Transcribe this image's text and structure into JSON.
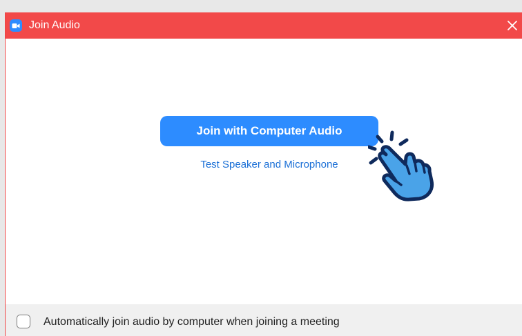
{
  "window": {
    "title": "Join Audio",
    "app_icon": "zoom-video-icon",
    "close_icon": "close-icon"
  },
  "main": {
    "join_button_label": "Join with Computer Audio",
    "test_link_label": "Test Speaker and Microphone",
    "pointer_icon": "pointing-hand-icon"
  },
  "footer": {
    "checkbox_checked": false,
    "checkbox_label": "Automatically join audio by computer when joining a meeting"
  },
  "colors": {
    "titlebar": "#f24949",
    "accent": "#2d8cff",
    "link": "#1a6fd6",
    "footer_bg": "#f0f0f0",
    "hand_fill": "#4aa3e8",
    "hand_outline": "#0f2a5c"
  }
}
